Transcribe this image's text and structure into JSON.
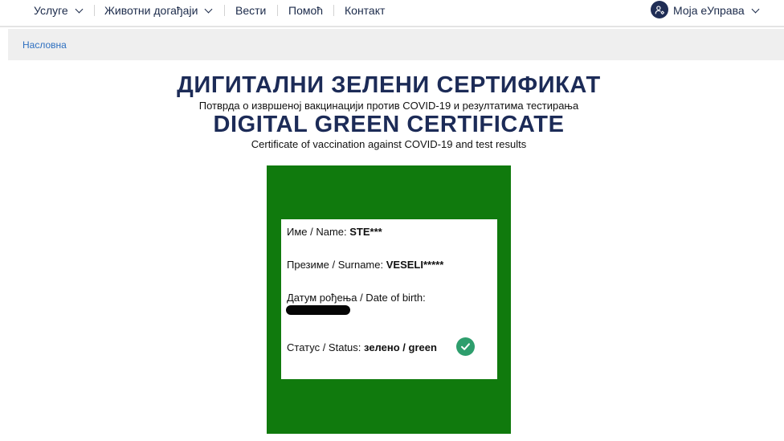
{
  "nav": {
    "items": [
      {
        "label": "Услуге",
        "has_dropdown": true
      },
      {
        "label": "Животни догађаји",
        "has_dropdown": true
      },
      {
        "label": "Вести",
        "has_dropdown": false
      },
      {
        "label": "Помоћ",
        "has_dropdown": false
      },
      {
        "label": "Контакт",
        "has_dropdown": false
      }
    ],
    "user_menu": {
      "label": "Моја еУправа",
      "icon": "user-settings-icon"
    }
  },
  "breadcrumb": {
    "home": "Насловна"
  },
  "header": {
    "title_sr": "ДИГИТАЛНИ ЗЕЛЕНИ СЕРТИФИКАТ",
    "subtitle_sr": "Потврда о извршеној вакцинацији против COVID-19 и резултатима тестирања",
    "title_en": "DIGITAL GREEN CERTIFICATE",
    "subtitle_en": "Certificate of vaccination against COVID-19 and test results"
  },
  "certificate": {
    "name_label": "Име / Name:",
    "name_value": "STE***",
    "surname_label": "Презиме / Surname:",
    "surname_value": "VESELI*****",
    "dob_label": "Датум рођења / Date of birth:",
    "status_label": "Статус / Status:",
    "status_value": "зелено / green",
    "status_icon": "check-circle-icon"
  },
  "colors": {
    "navy": "#1c2b57",
    "certificate_green": "#107a0d",
    "status_check": "#2e9e6d",
    "link_blue": "#2d6fc0"
  }
}
